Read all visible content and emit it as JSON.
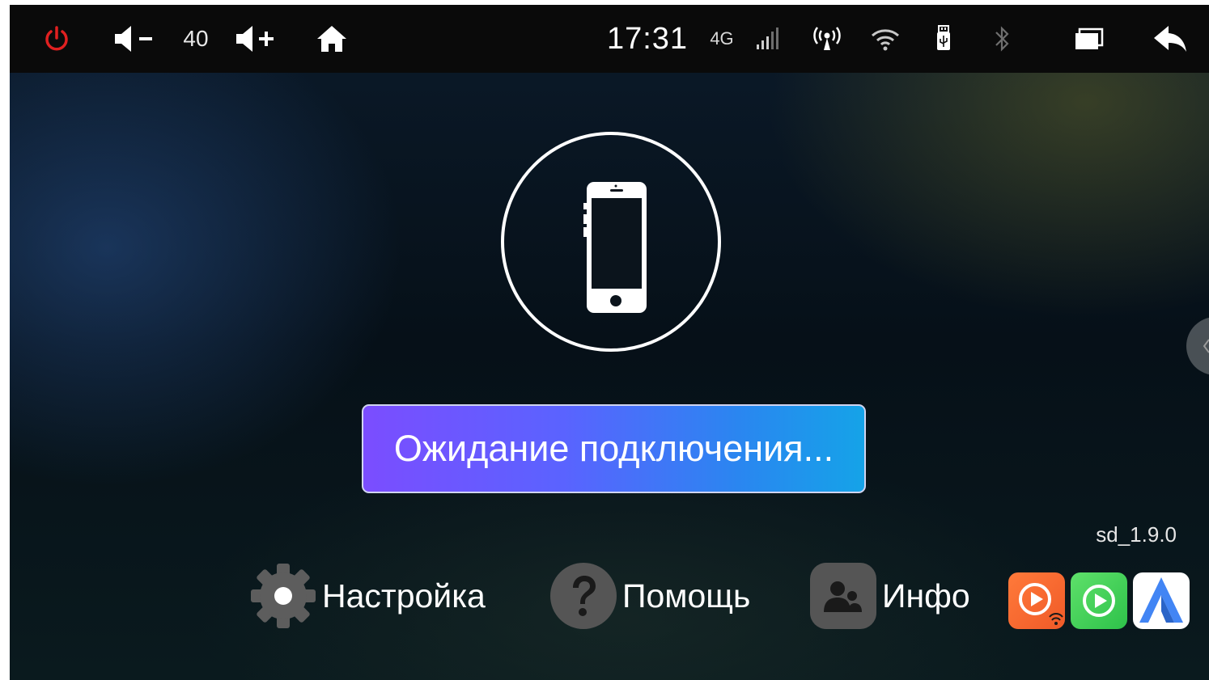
{
  "statusbar": {
    "icons": {
      "power": "power-icon",
      "volume_down": "volume-down-icon",
      "volume_up": "volume-up-icon",
      "home": "home-icon",
      "signal": "signal-bars-icon",
      "hotspot": "hotspot-icon",
      "wifi": "wifi-icon",
      "usb": "usb-icon",
      "bluetooth": "bluetooth-icon",
      "windows": "multi-window-icon",
      "back": "back-arrow-icon"
    },
    "volume_level": "40",
    "clock": "17:31",
    "network_type": "4G"
  },
  "main": {
    "phone_icon": "smartphone-icon",
    "connect_button_label": "Ожидание подключения...",
    "version": "sd_1.9.0"
  },
  "menu": {
    "settings_label": "Настройка",
    "help_label": "Помощь",
    "info_label": "Инфо"
  },
  "apps": {
    "carplay_wifi": "wireless-carplay-icon",
    "carplay": "carplay-icon",
    "android_auto": "android-auto-icon"
  },
  "colors": {
    "power_icon": "#e02020",
    "button_gradient_start": "#7b4dff",
    "button_gradient_end": "#15a3e8",
    "statusbar_bg": "#0a0a0a"
  }
}
